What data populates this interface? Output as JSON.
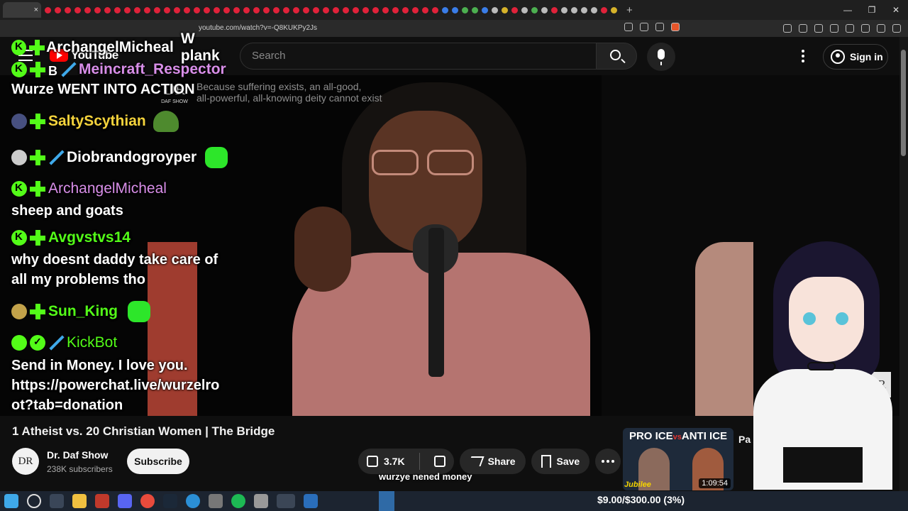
{
  "browser": {
    "url": "youtube.com/watch?v=-Q8KUKPy2Js",
    "tab_close": "×",
    "new_tab": "+",
    "window_controls": [
      "—",
      "❐",
      "✕"
    ]
  },
  "header": {
    "logo_text": "YouTube",
    "search_placeholder": "Search",
    "sign_in": "Sign in"
  },
  "video": {
    "overlay_quote_line1": "Because suffering exists, an all-good,",
    "overlay_quote_line2": "all-powerful, all-knowing deity cannot exist",
    "show_logo": "DR",
    "show_logo_sub": "DAF SHOW",
    "watermark": "DR",
    "caption": "wurzye nened money"
  },
  "chat": [
    {
      "user": "ArchangelMicheal",
      "color": "#ffffff",
      "text": "W plank"
    },
    {
      "user": "Meincraft_Respector",
      "color": "#d88ee8",
      "text": ""
    },
    {
      "line": "Wurze WENT INTO ACTION"
    },
    {
      "user": "SaltyScythian",
      "color": "#f4d33c"
    },
    {
      "user": "Diobrandogroyper",
      "color": "#ffffff"
    },
    {
      "user": "ArchangelMicheal",
      "color": "#d88ee8"
    },
    {
      "line": "sheep and goats"
    },
    {
      "user": "Avgvstvs14",
      "color": "#53fc18"
    },
    {
      "line": "why doesnt daddy take care of"
    },
    {
      "line": "all my problems tho"
    },
    {
      "user": "Sun_King",
      "color": "#53fc18"
    },
    {
      "user": "KickBot",
      "color": "#53fc18"
    },
    {
      "line": "Send in Money. I love you."
    },
    {
      "line": "https://powerchat.live/wurzelro"
    },
    {
      "line": "ot?tab=donation"
    }
  ],
  "chat_badge_b": "B",
  "meta": {
    "title": "1 Atheist vs. 20 Christian Women | The Bridge",
    "channel_name": "Dr. Daf Show",
    "channel_avatar": "DR",
    "subscribers": "238K subscribers",
    "subscribe": "Subscribe",
    "likes": "3.7K",
    "share": "Share",
    "save": "Save"
  },
  "recommendation": {
    "headline_left": "PRO ICE",
    "headline_vs": "vs",
    "headline_right": "ANTI ICE",
    "label": "Jubilee",
    "duration": "1:09:54",
    "title_fragment": "Pa Ag"
  },
  "taskbar": {
    "donation": "$9.00/$300.00 (3%)"
  }
}
